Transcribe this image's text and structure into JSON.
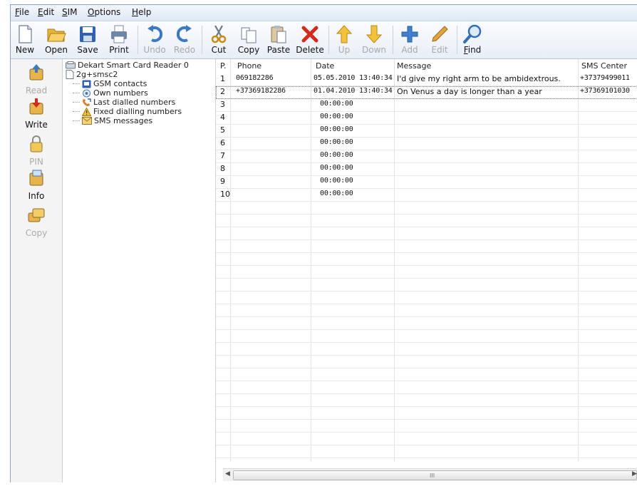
{
  "menu": [
    {
      "mnemonic": "F",
      "rest": "ile"
    },
    {
      "mnemonic": "E",
      "rest": "dit"
    },
    {
      "mnemonic": "S",
      "rest": "IM"
    },
    {
      "mnemonic": "O",
      "rest": "ptions"
    },
    {
      "mnemonic": "H",
      "rest": "elp"
    }
  ],
  "toolbar": {
    "new": "New",
    "open": "Open",
    "save": "Save",
    "print": "Print",
    "undo": "Undo",
    "redo": "Redo",
    "cut": "Cut",
    "copy": "Copy",
    "paste": "Paste",
    "delete": "Delete",
    "up": "Up",
    "down": "Down",
    "add": "Add",
    "edit": "Edit",
    "find_mnemonic": "F",
    "find_rest": "ind"
  },
  "sidebar": {
    "read": "Read",
    "write": "Write",
    "pin": "PIN",
    "info": "Info",
    "copy": "Copy"
  },
  "tree": {
    "reader": "Dekart Smart Card Reader 0",
    "card": "2g+smsc2",
    "items": [
      "GSM contacts",
      "Own numbers",
      "Last dialled numbers",
      "Fixed dialling numbers",
      "SMS messages"
    ]
  },
  "table": {
    "headers": {
      "pos": "P.",
      "phone": "Phone",
      "date": "Date",
      "message": "Message",
      "center": "SMS Center"
    },
    "rows": [
      {
        "pos": "1",
        "phone": "069182286",
        "date": "05.05.2010 13:40:34",
        "message": "I'd give my right arm to be ambidextrous.",
        "center": "+37379499011"
      },
      {
        "pos": "2",
        "phone": "+37369182286",
        "date": "01.04.2010 13:40:34",
        "message": "On Venus a day is longer than a year",
        "center": "+37369101030"
      },
      {
        "pos": "3",
        "phone": "",
        "date": "00:00:00",
        "message": "",
        "center": ""
      },
      {
        "pos": "4",
        "phone": "",
        "date": "00:00:00",
        "message": "",
        "center": ""
      },
      {
        "pos": "5",
        "phone": "",
        "date": "00:00:00",
        "message": "",
        "center": ""
      },
      {
        "pos": "6",
        "phone": "",
        "date": "00:00:00",
        "message": "",
        "center": ""
      },
      {
        "pos": "7",
        "phone": "",
        "date": "00:00:00",
        "message": "",
        "center": ""
      },
      {
        "pos": "8",
        "phone": "",
        "date": "00:00:00",
        "message": "",
        "center": ""
      },
      {
        "pos": "9",
        "phone": "",
        "date": "00:00:00",
        "message": "",
        "center": ""
      },
      {
        "pos": "10",
        "phone": "",
        "date": "00:00:00",
        "message": "",
        "center": ""
      }
    ]
  },
  "scrollbar": {
    "left": "◀",
    "right": "▶",
    "grip": "III"
  }
}
